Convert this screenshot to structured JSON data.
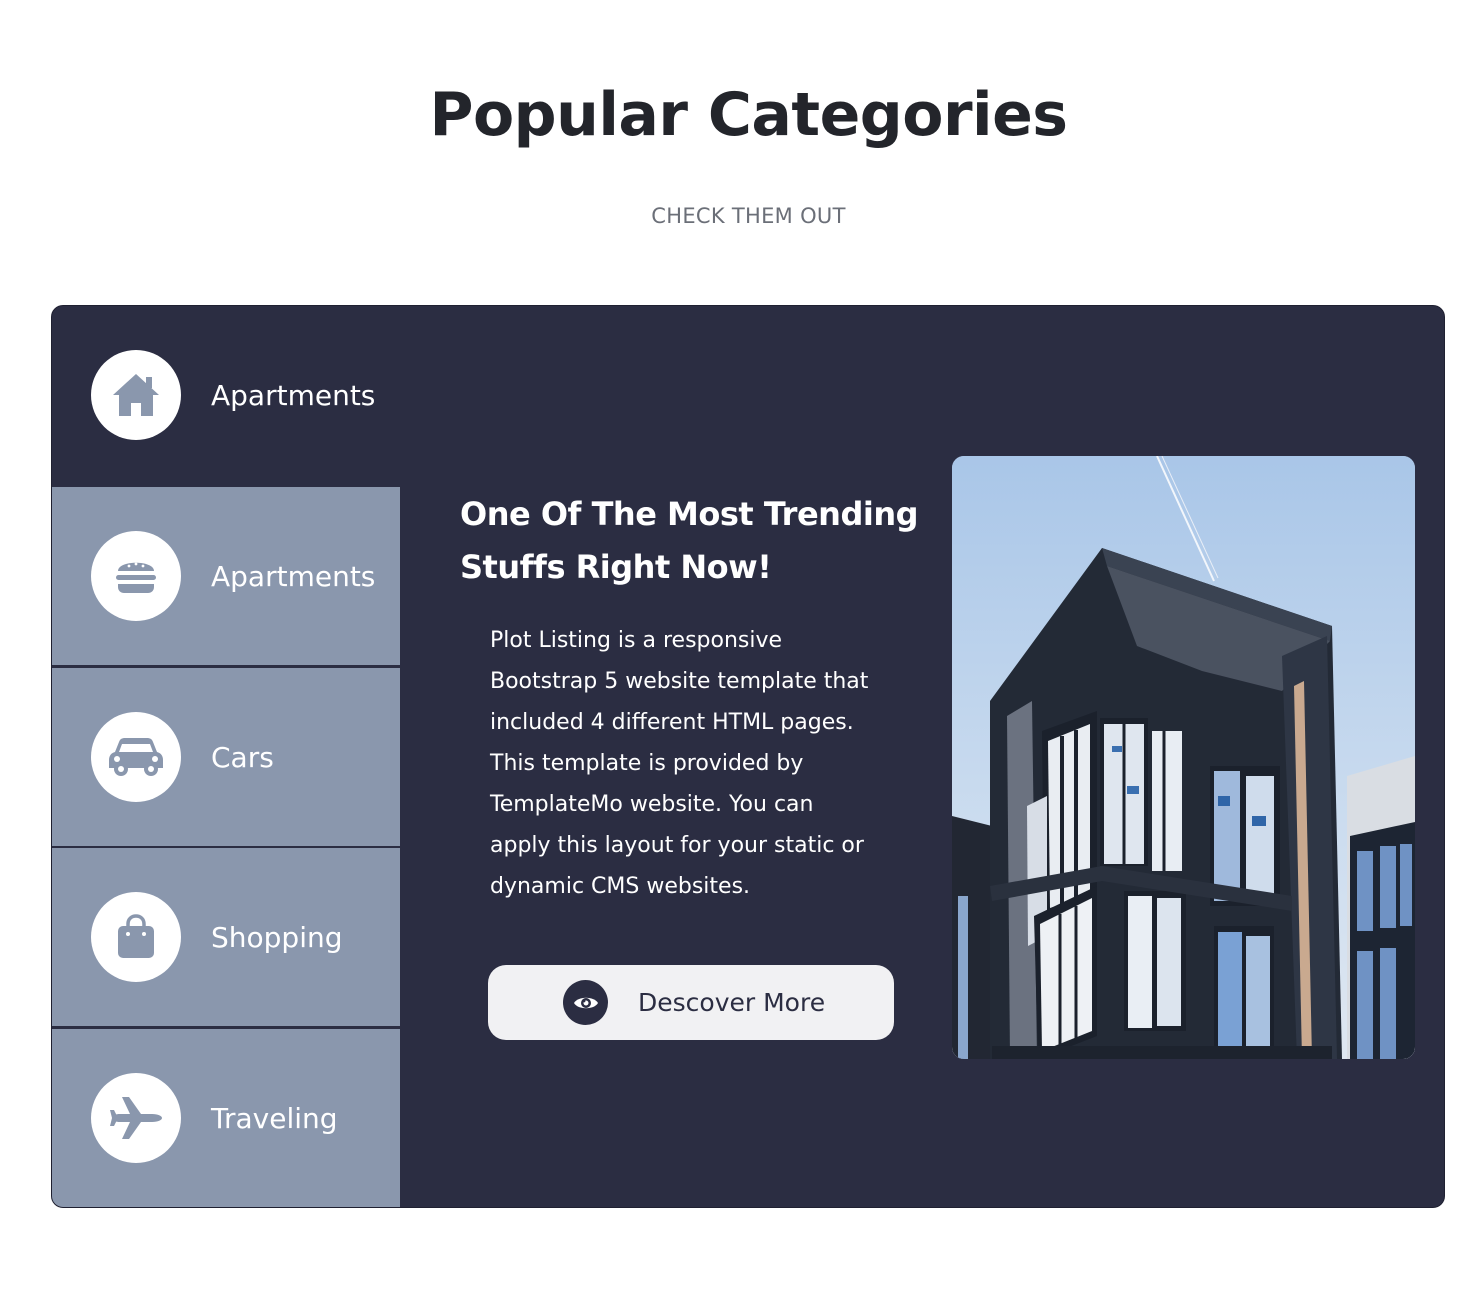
{
  "section": {
    "title": "Popular Categories",
    "subtitle": "CHECK THEM OUT"
  },
  "tabs": [
    {
      "label": "Apartments",
      "icon": "house-icon",
      "active": true
    },
    {
      "label": "Apartments",
      "icon": "burger-icon",
      "active": false
    },
    {
      "label": "Cars",
      "icon": "car-icon",
      "active": false
    },
    {
      "label": "Shopping",
      "icon": "shopping-bag-icon",
      "active": false
    },
    {
      "label": "Traveling",
      "icon": "airplane-icon",
      "active": false
    }
  ],
  "content": {
    "title": "One Of The Most Trending Stuffs Right Now!",
    "description": "Plot Listing is a responsive Bootstrap 5 website template that included 4 different HTML pages. This template is provided by TemplateMo website. You can apply this layout for your static or dynamic CMS websites.",
    "button_label": "Descover More"
  },
  "colors": {
    "panel_bg": "#2b2d42",
    "tab_inactive_bg": "#8a97ad",
    "icon_color": "#8a97ad",
    "button_bg": "#f1f1f3"
  }
}
